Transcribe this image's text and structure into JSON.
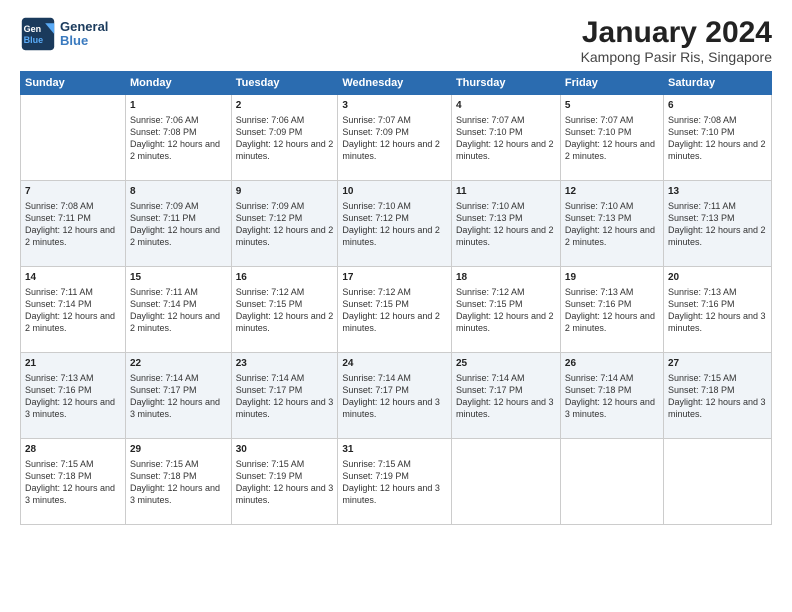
{
  "logo": {
    "line1": "General",
    "line2": "Blue"
  },
  "title": "January 2024",
  "subtitle": "Kampong Pasir Ris, Singapore",
  "weekdays": [
    "Sunday",
    "Monday",
    "Tuesday",
    "Wednesday",
    "Thursday",
    "Friday",
    "Saturday"
  ],
  "rows": [
    [
      {
        "day": "",
        "info": ""
      },
      {
        "day": "1",
        "info": "Sunrise: 7:06 AM\nSunset: 7:08 PM\nDaylight: 12 hours and 2 minutes."
      },
      {
        "day": "2",
        "info": "Sunrise: 7:06 AM\nSunset: 7:09 PM\nDaylight: 12 hours and 2 minutes."
      },
      {
        "day": "3",
        "info": "Sunrise: 7:07 AM\nSunset: 7:09 PM\nDaylight: 12 hours and 2 minutes."
      },
      {
        "day": "4",
        "info": "Sunrise: 7:07 AM\nSunset: 7:10 PM\nDaylight: 12 hours and 2 minutes."
      },
      {
        "day": "5",
        "info": "Sunrise: 7:07 AM\nSunset: 7:10 PM\nDaylight: 12 hours and 2 minutes."
      },
      {
        "day": "6",
        "info": "Sunrise: 7:08 AM\nSunset: 7:10 PM\nDaylight: 12 hours and 2 minutes."
      }
    ],
    [
      {
        "day": "7",
        "info": "Sunrise: 7:08 AM\nSunset: 7:11 PM\nDaylight: 12 hours and 2 minutes."
      },
      {
        "day": "8",
        "info": "Sunrise: 7:09 AM\nSunset: 7:11 PM\nDaylight: 12 hours and 2 minutes."
      },
      {
        "day": "9",
        "info": "Sunrise: 7:09 AM\nSunset: 7:12 PM\nDaylight: 12 hours and 2 minutes."
      },
      {
        "day": "10",
        "info": "Sunrise: 7:10 AM\nSunset: 7:12 PM\nDaylight: 12 hours and 2 minutes."
      },
      {
        "day": "11",
        "info": "Sunrise: 7:10 AM\nSunset: 7:13 PM\nDaylight: 12 hours and 2 minutes."
      },
      {
        "day": "12",
        "info": "Sunrise: 7:10 AM\nSunset: 7:13 PM\nDaylight: 12 hours and 2 minutes."
      },
      {
        "day": "13",
        "info": "Sunrise: 7:11 AM\nSunset: 7:13 PM\nDaylight: 12 hours and 2 minutes."
      }
    ],
    [
      {
        "day": "14",
        "info": "Sunrise: 7:11 AM\nSunset: 7:14 PM\nDaylight: 12 hours and 2 minutes."
      },
      {
        "day": "15",
        "info": "Sunrise: 7:11 AM\nSunset: 7:14 PM\nDaylight: 12 hours and 2 minutes."
      },
      {
        "day": "16",
        "info": "Sunrise: 7:12 AM\nSunset: 7:15 PM\nDaylight: 12 hours and 2 minutes."
      },
      {
        "day": "17",
        "info": "Sunrise: 7:12 AM\nSunset: 7:15 PM\nDaylight: 12 hours and 2 minutes."
      },
      {
        "day": "18",
        "info": "Sunrise: 7:12 AM\nSunset: 7:15 PM\nDaylight: 12 hours and 2 minutes."
      },
      {
        "day": "19",
        "info": "Sunrise: 7:13 AM\nSunset: 7:16 PM\nDaylight: 12 hours and 2 minutes."
      },
      {
        "day": "20",
        "info": "Sunrise: 7:13 AM\nSunset: 7:16 PM\nDaylight: 12 hours and 3 minutes."
      }
    ],
    [
      {
        "day": "21",
        "info": "Sunrise: 7:13 AM\nSunset: 7:16 PM\nDaylight: 12 hours and 3 minutes."
      },
      {
        "day": "22",
        "info": "Sunrise: 7:14 AM\nSunset: 7:17 PM\nDaylight: 12 hours and 3 minutes."
      },
      {
        "day": "23",
        "info": "Sunrise: 7:14 AM\nSunset: 7:17 PM\nDaylight: 12 hours and 3 minutes."
      },
      {
        "day": "24",
        "info": "Sunrise: 7:14 AM\nSunset: 7:17 PM\nDaylight: 12 hours and 3 minutes."
      },
      {
        "day": "25",
        "info": "Sunrise: 7:14 AM\nSunset: 7:17 PM\nDaylight: 12 hours and 3 minutes."
      },
      {
        "day": "26",
        "info": "Sunrise: 7:14 AM\nSunset: 7:18 PM\nDaylight: 12 hours and 3 minutes."
      },
      {
        "day": "27",
        "info": "Sunrise: 7:15 AM\nSunset: 7:18 PM\nDaylight: 12 hours and 3 minutes."
      }
    ],
    [
      {
        "day": "28",
        "info": "Sunrise: 7:15 AM\nSunset: 7:18 PM\nDaylight: 12 hours and 3 minutes."
      },
      {
        "day": "29",
        "info": "Sunrise: 7:15 AM\nSunset: 7:18 PM\nDaylight: 12 hours and 3 minutes."
      },
      {
        "day": "30",
        "info": "Sunrise: 7:15 AM\nSunset: 7:19 PM\nDaylight: 12 hours and 3 minutes."
      },
      {
        "day": "31",
        "info": "Sunrise: 7:15 AM\nSunset: 7:19 PM\nDaylight: 12 hours and 3 minutes."
      },
      {
        "day": "",
        "info": ""
      },
      {
        "day": "",
        "info": ""
      },
      {
        "day": "",
        "info": ""
      }
    ]
  ]
}
